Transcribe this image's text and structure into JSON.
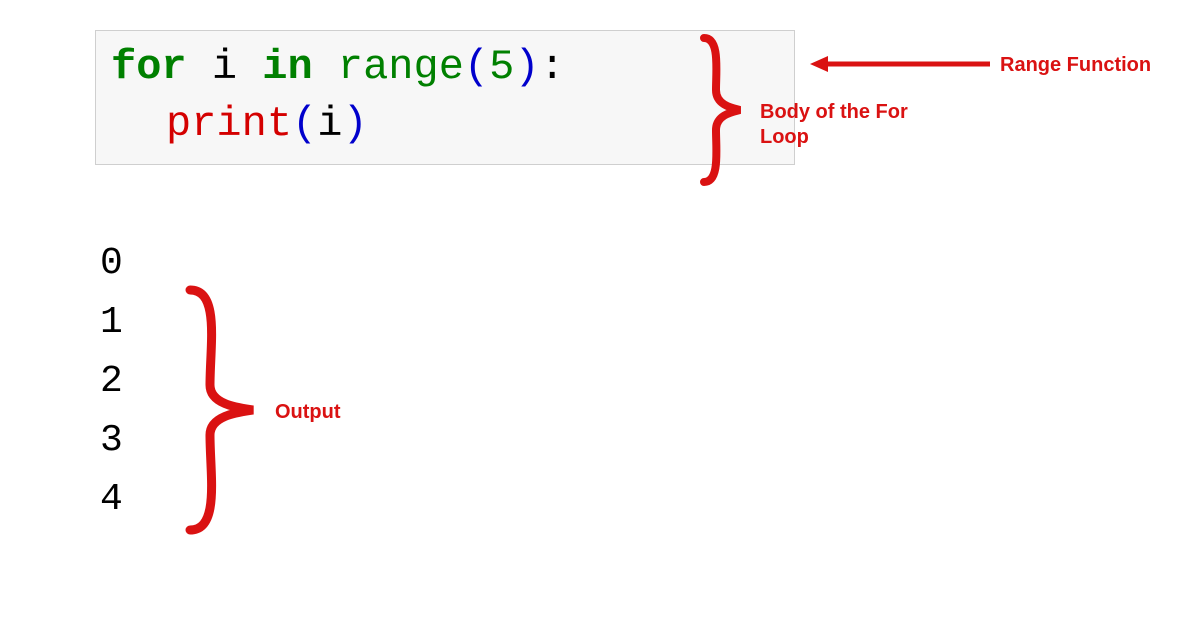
{
  "code": {
    "line1": {
      "for": "for",
      "var": " i ",
      "in": "in",
      "space": " ",
      "func": "range",
      "open": "(",
      "arg": "5",
      "close": ")",
      "colon": ":"
    },
    "line2": {
      "print": "print",
      "open": "(",
      "arg": "i",
      "close": ")"
    }
  },
  "output": [
    "0",
    "1",
    "2",
    "3",
    "4"
  ],
  "annotations": {
    "range_function": "Range Function",
    "body": "Body of the For Loop",
    "output": "Output"
  },
  "colors": {
    "annotation": "#da1212"
  }
}
